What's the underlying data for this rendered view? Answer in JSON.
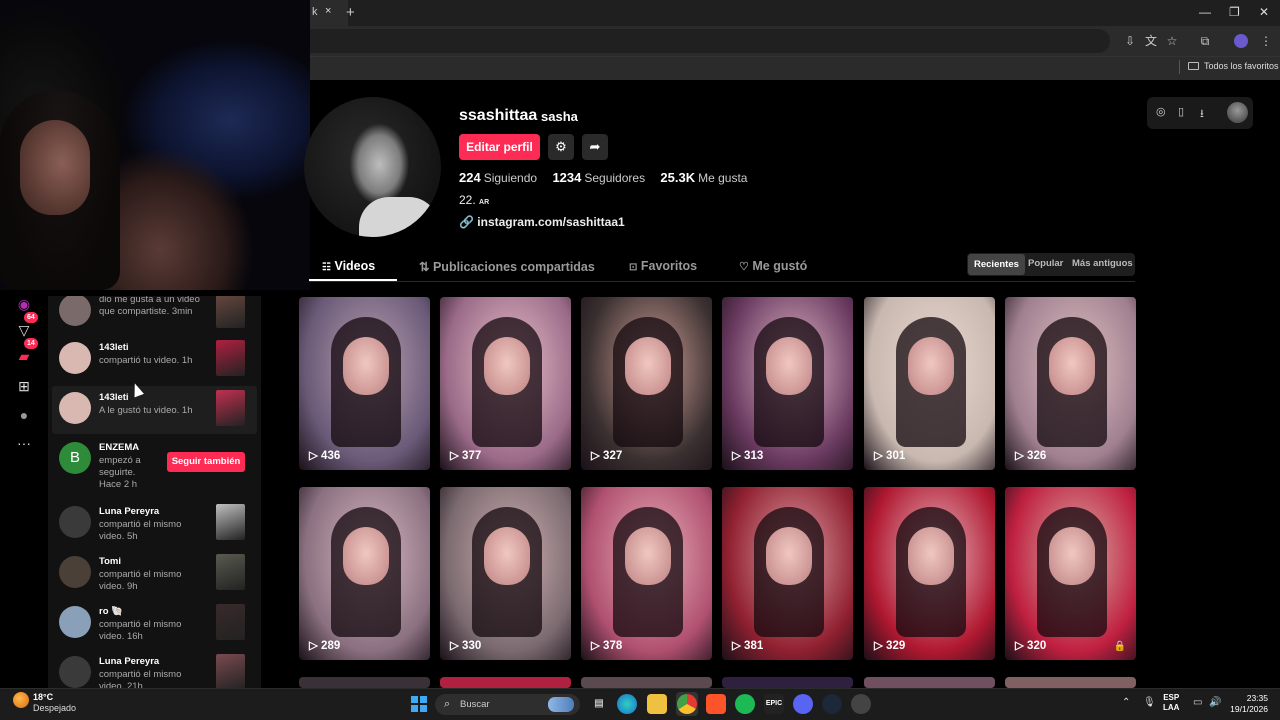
{
  "browser": {
    "tab_title": "k",
    "close_tab": "×",
    "new_tab": "+",
    "window_controls": [
      "—",
      "❐",
      "✕"
    ],
    "bookmarks_folder": "Todos los favoritos"
  },
  "sidebar": {
    "badges": {
      "inbox": "64",
      "messages": "14"
    }
  },
  "notifications": [
    {
      "name": "",
      "text_lines": [
        "dio me gusta a un video",
        "que compartiste. 3min"
      ],
      "avatar_color": "#7a6a6a",
      "thumb_color": "#6a4a40"
    },
    {
      "name": "143leti",
      "text_lines": [
        "compartió tu video. 1h"
      ],
      "avatar_color": "#d8b8b0",
      "thumb_color": "#b02040"
    },
    {
      "name": "143leti",
      "text_lines": [
        "A le gustó tu video. 1h"
      ],
      "avatar_color": "#d8b8b0",
      "thumb_color": "#c03050"
    },
    {
      "name": "ENZEMA",
      "text_lines": [
        "empezó a",
        "seguirte.",
        "Hace 2 h"
      ],
      "avatar_letter": "B",
      "avatar_color": "#2e8b3a",
      "follow_label": "Seguir también"
    },
    {
      "name": "Luna Pereyra",
      "text_lines": [
        "compartió el mismo",
        "video. 5h"
      ],
      "avatar_color": "#3a3a3a",
      "thumb_color": "#c0c0c0"
    },
    {
      "name": "Tomi",
      "text_lines": [
        "compartió el mismo",
        "video. 9h"
      ],
      "avatar_color": "#4a4038",
      "thumb_color": "#5a5a50"
    },
    {
      "name": "ro 🐚",
      "text_lines": [
        "compartió el mismo",
        "video. 16h"
      ],
      "avatar_color": "#8aa0b8",
      "thumb_color": "#3a2a2a"
    },
    {
      "name": "Luna Pereyra",
      "text_lines": [
        "compartió el mismo",
        "video. 21h"
      ],
      "avatar_color": "#3a3a3a",
      "thumb_color": "#7a4a50"
    }
  ],
  "profile": {
    "username": "ssashittaa",
    "nickname": "sasha",
    "edit_button": "Editar perfil",
    "following_count": "224",
    "following_label": "Siguiendo",
    "followers_count": "1234",
    "followers_label": "Seguidores",
    "likes_count": "25.3K",
    "likes_label": "Me gusta",
    "bio": "22.",
    "bio_small": "AR",
    "link": "instagram.com/sashittaa1"
  },
  "tabs": [
    {
      "icon": "⦙⦙⦙",
      "label": "Videos",
      "active": true
    },
    {
      "icon": "⇅",
      "label": "Publicaciones compartidas",
      "active": false
    },
    {
      "icon": "🔖",
      "label": "Favoritos",
      "active": false
    },
    {
      "icon": "♡",
      "label": "Me gustó",
      "active": false
    }
  ],
  "sort_options": [
    "Recientes",
    "Popular",
    "Más antiguos"
  ],
  "videos": [
    {
      "views": "436",
      "colors": [
        "#6a5a78",
        "#b8a0b0"
      ]
    },
    {
      "views": "377",
      "colors": [
        "#9a6a88",
        "#e8c0c8"
      ]
    },
    {
      "views": "327",
      "colors": [
        "#3a3030",
        "#d0a098"
      ]
    },
    {
      "views": "313",
      "colors": [
        "#6a3a60",
        "#e0b8c8"
      ]
    },
    {
      "views": "301",
      "colors": [
        "#c8b8b0",
        "#e8d8d0"
      ]
    },
    {
      "views": "326",
      "colors": [
        "#a08090",
        "#e0c0c0"
      ]
    },
    {
      "views": "289",
      "colors": [
        "#8a7080",
        "#d8b8c0"
      ]
    },
    {
      "views": "330",
      "colors": [
        "#7a6a70",
        "#d0b0b0"
      ]
    },
    {
      "views": "378",
      "colors": [
        "#b05070",
        "#e8b0b8"
      ]
    },
    {
      "views": "381",
      "colors": [
        "#902030",
        "#e0a0a8"
      ]
    },
    {
      "views": "329",
      "colors": [
        "#b01830",
        "#e8b8c0"
      ]
    },
    {
      "views": "320",
      "colors": [
        "#c02040",
        "#d8b0a8"
      ],
      "locked": true
    }
  ],
  "taskbar": {
    "temperature": "18°C",
    "condition": "Despejado",
    "search_placeholder": "Buscar",
    "lang_top": "ESP",
    "lang_bottom": "LAA",
    "time": "23:35",
    "date": "19/1/2026"
  }
}
